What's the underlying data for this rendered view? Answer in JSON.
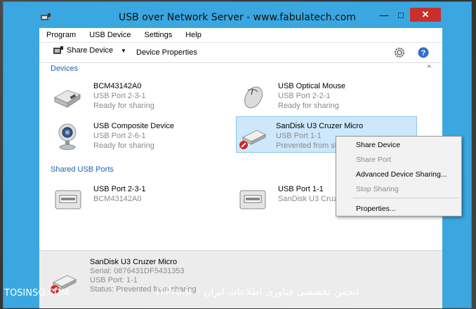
{
  "window": {
    "title": "USB over Network Server - www.fabulatech.com",
    "minimize": "—",
    "maximize": "□",
    "close": "✕"
  },
  "menu": [
    "Program",
    "USB Device",
    "Settings",
    "Help"
  ],
  "toolbar": {
    "share_label": "Share Device",
    "share_caret": "▼",
    "properties_label": "Device Properties"
  },
  "sections": {
    "devices": "Devices",
    "ports": "Shared USB Ports",
    "collapse": "^"
  },
  "devices": [
    {
      "name": "BCM43142A0",
      "port": "USB Port  2-3-1",
      "status": "Ready for sharing",
      "icon": "usb-device-icon"
    },
    {
      "name": "USB Optical Mouse",
      "port": "USB Port  2-2-1",
      "status": "Ready for sharing",
      "icon": "mouse-icon"
    },
    {
      "name": "USB Composite Device",
      "port": "USB Port  2-6-1",
      "status": "Ready for sharing",
      "icon": "webcam-icon"
    },
    {
      "name": "SanDisk U3 Cruzer Micro",
      "port": "USB Port  1-1",
      "status": "Prevented from sharing",
      "icon": "usb-drive-blocked-icon"
    }
  ],
  "ports": [
    {
      "name": "USB Port  2-3-1",
      "device": "BCM43142A0"
    },
    {
      "name": "USB Port  1-1",
      "device": "SanDisk U3 Cruzer Micro"
    }
  ],
  "context_menu": {
    "share": "Share Device",
    "share_port": "Share Port",
    "advanced": "Advanced Device Sharing...",
    "stop": "Stop Sharing",
    "properties": "Properties..."
  },
  "details": {
    "name": "SanDisk U3 Cruzer Micro",
    "serial": "Serial: 0876431DF5431353",
    "port": "USB Port: 1-1",
    "status": "Status: Prevented from sharing"
  },
  "watermark": {
    "left": "TOSINSO.COM",
    "right": "ITPro.ir - انجمن تخصصی فناوری اطلاعات ایران"
  },
  "colors": {
    "frame": "#3aa7e0",
    "section_title": "#1f5fb8",
    "selection": "#cde8fb",
    "close_button": "#c9302c"
  }
}
